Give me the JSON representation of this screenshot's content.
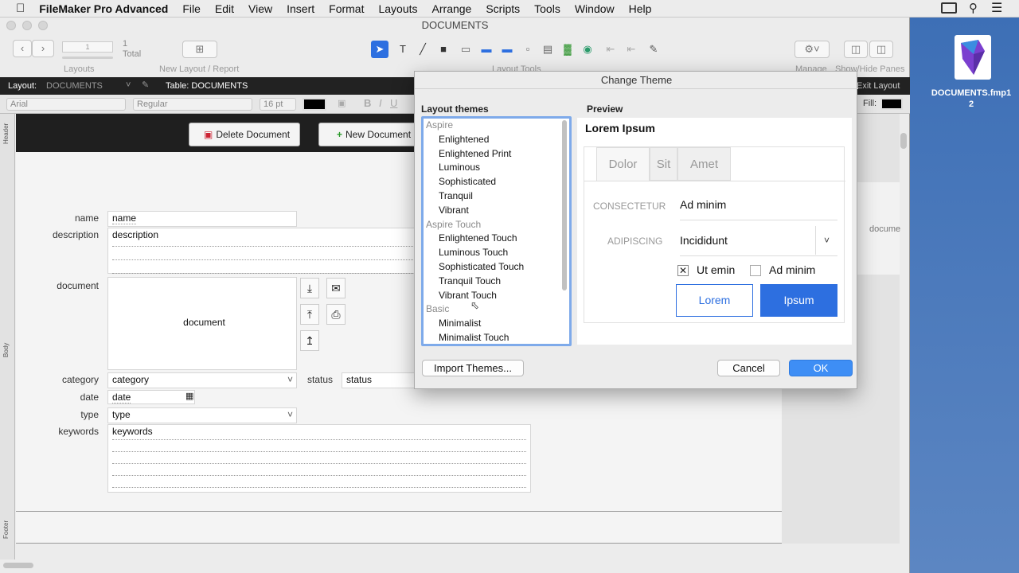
{
  "menubar": {
    "apple": "",
    "app": "FileMaker Pro Advanced",
    "items": [
      "File",
      "Edit",
      "View",
      "Insert",
      "Format",
      "Layouts",
      "Arrange",
      "Scripts",
      "Tools",
      "Window",
      "Help"
    ]
  },
  "window": {
    "title": "DOCUMENTS"
  },
  "toolbar": {
    "record_value": "1",
    "record_count": "1",
    "total_label": "Total",
    "layouts_label": "Layouts",
    "new_layout_label": "New Layout / Report",
    "layout_tools_label": "Layout Tools",
    "manage_label": "Manage",
    "show_hide_label": "Show/Hide Panes",
    "exit_layout_label": "Exit Layout"
  },
  "layoutbar": {
    "layout_label": "Layout:",
    "layout_name": "DOCUMENTS",
    "table_label": "Table: DOCUMENTS"
  },
  "formatbar": {
    "font": "Arial",
    "style": "Regular",
    "size": "16 pt",
    "fill_label": "Fill:"
  },
  "parts": {
    "header": "Header",
    "body": "Body",
    "footer": "Footer"
  },
  "header_buttons": {
    "delete": "Delete Document",
    "new": "New Document"
  },
  "fields": {
    "name_label": "name",
    "name_value": "name",
    "description_label": "description",
    "description_value": "description",
    "document_label": "document",
    "document_value": "document",
    "category_label": "category",
    "category_value": "category",
    "status_label": "status",
    "status_value": "status",
    "date_label": "date",
    "date_value": "date",
    "type_label": "type",
    "type_value": "type",
    "keywords_label": "keywords",
    "keywords_value": "keywords"
  },
  "right_panel": {
    "text": "docume"
  },
  "dialog": {
    "title": "Change Theme",
    "themes_header": "Layout themes",
    "preview_header": "Preview",
    "groups": [
      {
        "name": "Aspire",
        "items": [
          "Enlightened",
          "Enlightened Print",
          "Luminous",
          "Sophisticated",
          "Tranquil",
          "Vibrant"
        ]
      },
      {
        "name": "Aspire Touch",
        "items": [
          "Enlightened Touch",
          "Luminous Touch",
          "Sophisticated Touch",
          "Tranquil Touch",
          "Vibrant Touch"
        ]
      },
      {
        "name": "Basic",
        "items": [
          "Minimalist",
          "Minimalist Touch"
        ]
      }
    ],
    "preview": {
      "title": "Lorem Ipsum",
      "tabs": [
        "Dolor",
        "Sit",
        "Amet"
      ],
      "field1_label": "CONSECTETUR",
      "field1_value": "Ad minim",
      "field2_label": "ADIPISCING",
      "field2_value": "Incididunt",
      "check1": "Ut emin",
      "check2": "Ad minim",
      "btn1": "Lorem",
      "btn2": "Ipsum"
    },
    "import_button": "Import Themes...",
    "cancel_button": "Cancel",
    "ok_button": "OK"
  },
  "desktop": {
    "file_name_line1": "DOCUMENTS.fmp1",
    "file_name_line2": "2"
  }
}
